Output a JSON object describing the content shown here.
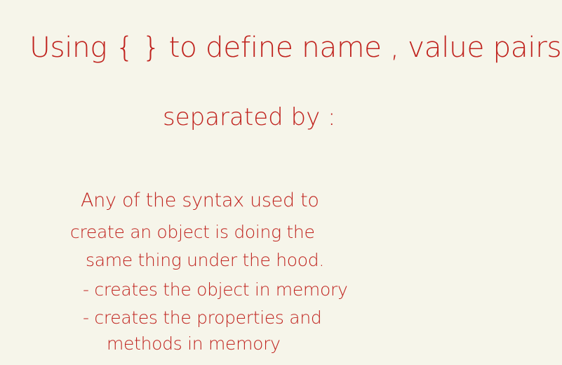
{
  "heading": {
    "line1": "Using { } to define name , value pairs",
    "line2": "separated by :"
  },
  "notes": {
    "lines": [
      "Any of the syntax used to",
      "create an object is doing the",
      "same thing under the hood.",
      "- creates the object in memory",
      "- creates the properties and",
      "methods in memory"
    ]
  },
  "colors": {
    "ink": "#c0241f",
    "background": "#f6f5ea"
  }
}
